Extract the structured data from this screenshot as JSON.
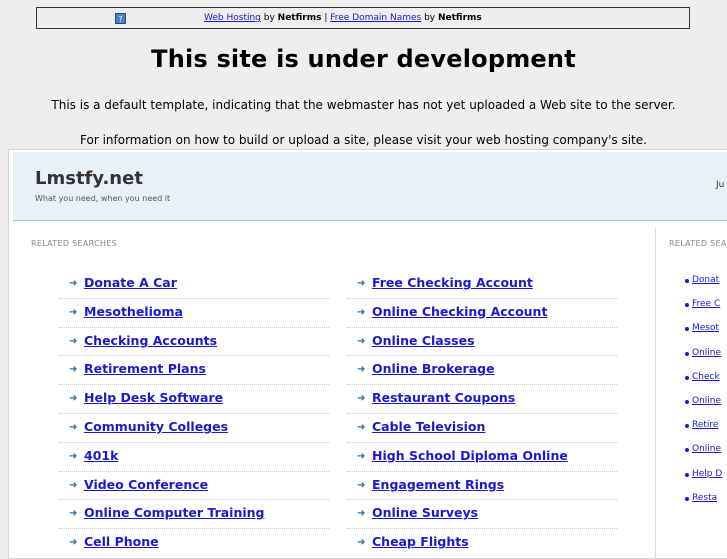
{
  "topbar": {
    "help_icon": "?",
    "link1": "Web Hosting",
    "by1": " by ",
    "brand1": "Netfirms",
    "sep": " | ",
    "link2": "Free Domain Names",
    "by2": " by ",
    "brand2": "Netfirms"
  },
  "page": {
    "headline": "This site is under development",
    "para1": "This is a default template, indicating that the webmaster has not yet uploaded a Web site to the server.",
    "para2": "For information on how to build or upload a site, please visit your web hosting company's site."
  },
  "parked": {
    "title": "Lmstfy.net",
    "tagline": "What you need, when you need it",
    "date_stub": "Ju",
    "related_label": "RELATED SEARCHES",
    "side_label": "RELATED SEA",
    "arrow_icon": "arrow-right-icon",
    "left_links": [
      "Donate A Car",
      "Mesothelioma",
      "Checking Accounts",
      "Retirement Plans",
      "Help Desk Software",
      "Community Colleges",
      "401k",
      "Video Conference",
      "Online Computer Training",
      "Cell Phone"
    ],
    "right_links": [
      "Free Checking Account",
      "Online Checking Account",
      "Online Classes",
      "Online Brokerage",
      "Restaurant Coupons",
      "Cable Television",
      "High School Diploma Online",
      "Engagement Rings",
      "Online Surveys",
      "Cheap Flights"
    ],
    "side_links": [
      "Donat",
      "Free C",
      "Mesot",
      "Online",
      "Check",
      "Online",
      "Retire",
      "Online",
      "Help D",
      "Resta"
    ]
  }
}
